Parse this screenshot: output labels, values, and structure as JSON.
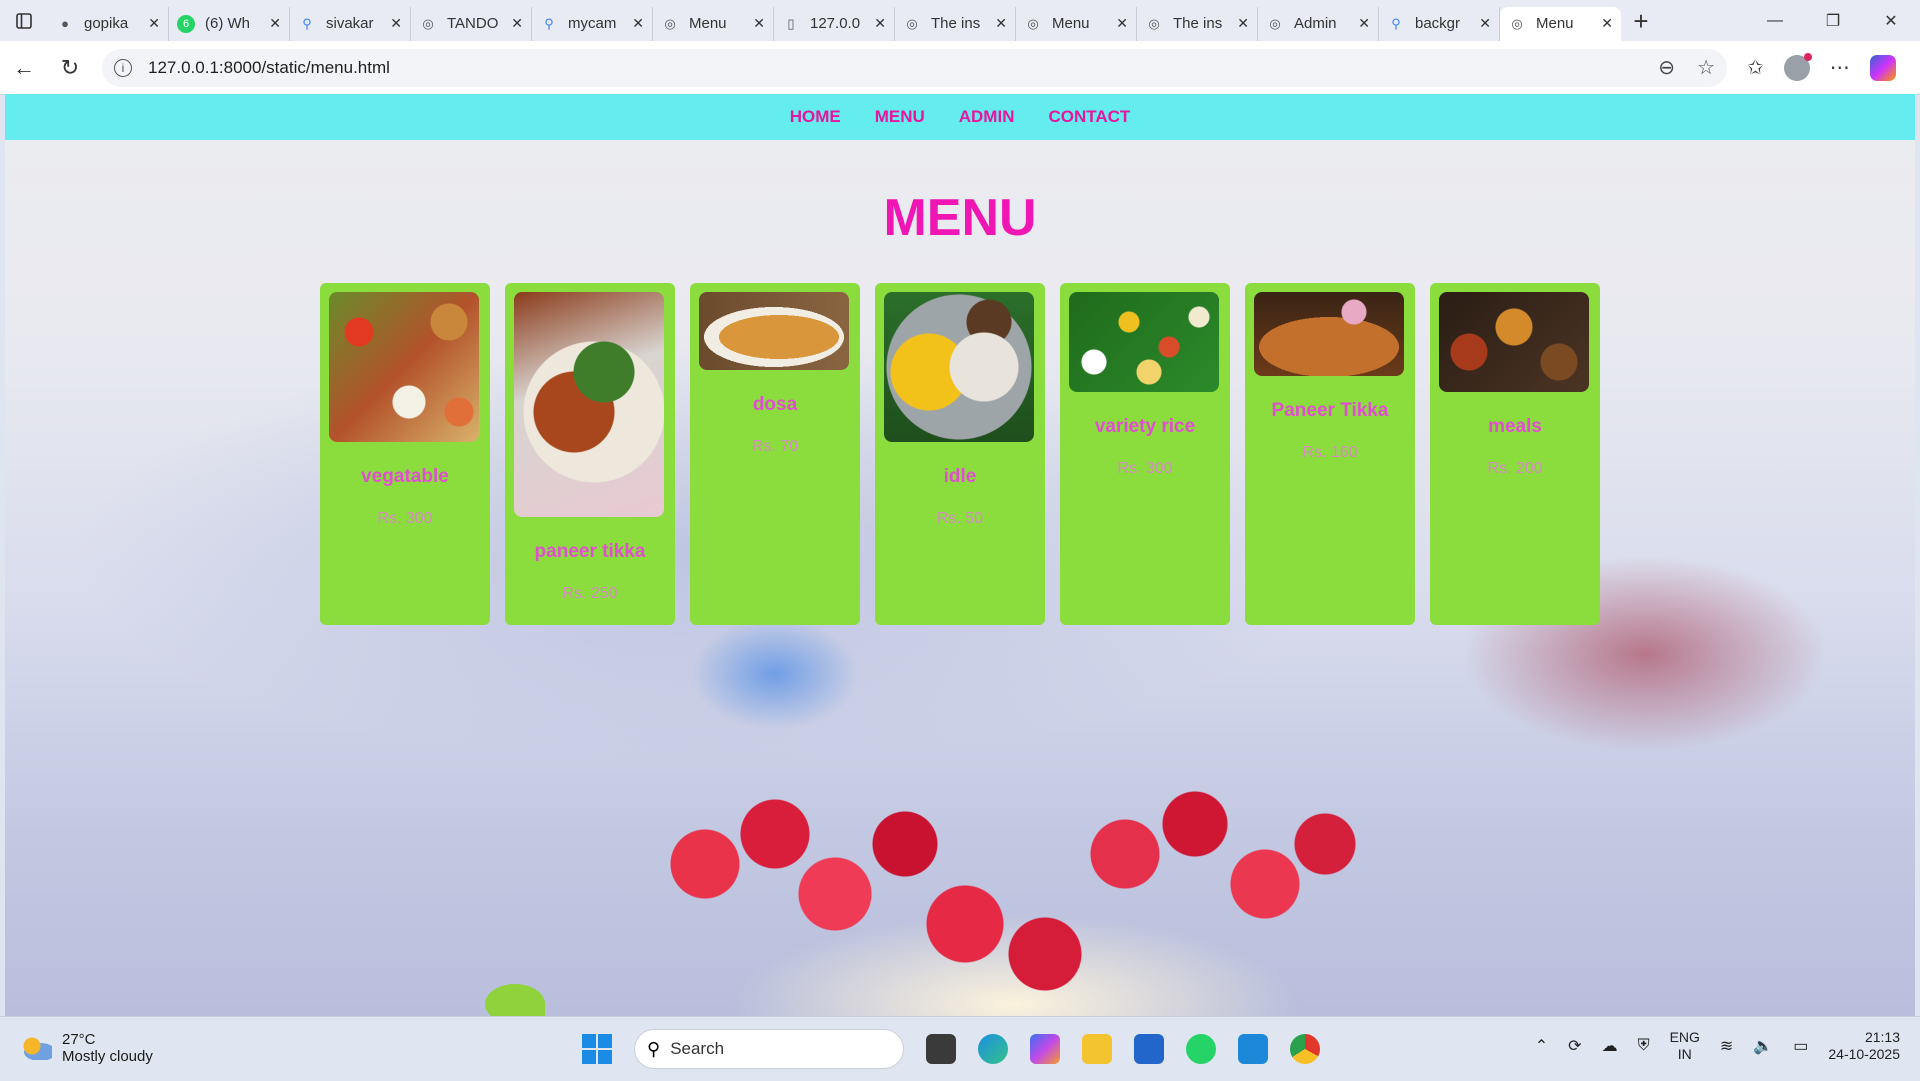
{
  "browser": {
    "tabs": [
      {
        "icon": "github-icon",
        "title": "gopika"
      },
      {
        "icon": "whatsapp-icon",
        "title": "(6) Wh"
      },
      {
        "icon": "search-icon",
        "title": "sivakar"
      },
      {
        "icon": "globe-icon",
        "title": "TANDO"
      },
      {
        "icon": "search-icon",
        "title": "mycam"
      },
      {
        "icon": "globe-icon",
        "title": "Menu"
      },
      {
        "icon": "file-icon",
        "title": "127.0.0"
      },
      {
        "icon": "globe-icon",
        "title": "The ins"
      },
      {
        "icon": "globe-icon",
        "title": "Menu"
      },
      {
        "icon": "globe-icon",
        "title": "The ins"
      },
      {
        "icon": "globe-icon",
        "title": "Admin"
      },
      {
        "icon": "search-icon",
        "title": "backgr"
      }
    ],
    "active_tab": {
      "icon": "globe-icon",
      "title": "Menu"
    },
    "url": "127.0.0.1:8000/static/menu.html"
  },
  "nav": {
    "links": [
      "HOME",
      "MENU",
      "ADMIN",
      "CONTACT"
    ]
  },
  "page": {
    "title": "MENU",
    "items": [
      {
        "name": "vegatable",
        "price": "Rs. 300"
      },
      {
        "name": "paneer tikka",
        "price": "Rs. 250"
      },
      {
        "name": "dosa",
        "price": "Rs. 70"
      },
      {
        "name": "idle",
        "price": "Rs. 50"
      },
      {
        "name": "variety rice",
        "price": "Rs. 300"
      },
      {
        "name": "Paneer Tikka",
        "price": "Rs. 160"
      },
      {
        "name": "meals",
        "price": "Rs. 200"
      }
    ]
  },
  "colors": {
    "nav_bg": "#64ecee",
    "nav_link": "#e6169f",
    "title": "#f016b4",
    "card_bg": "#8bdc3d",
    "card_name": "#e04fd0",
    "card_price": "#d68bc4"
  },
  "taskbar": {
    "temperature": "27°C",
    "weather": "Mostly cloudy",
    "search_label": "Search",
    "lang_top": "ENG",
    "lang_bottom": "IN",
    "time": "21:13",
    "date": "24-10-2025"
  }
}
